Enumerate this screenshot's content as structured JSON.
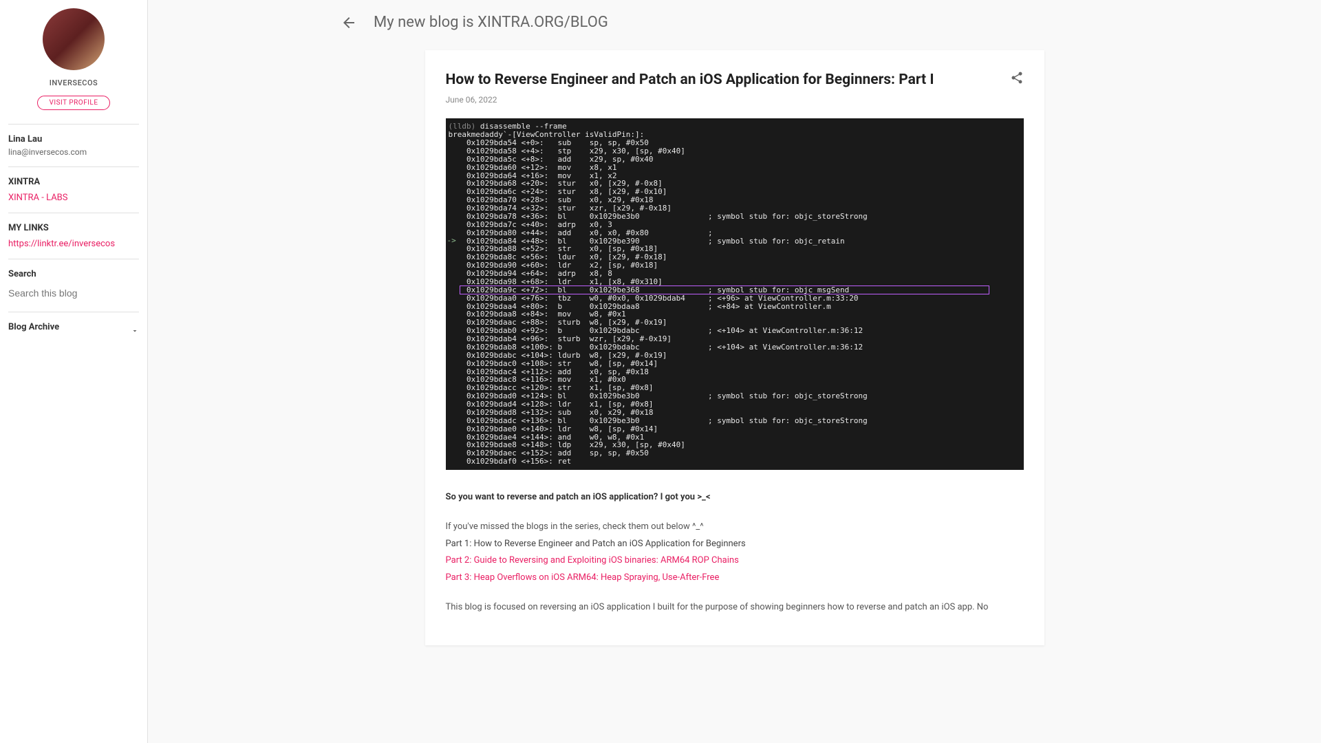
{
  "sidebar": {
    "author_name": "INVERSECOS",
    "visit_profile": "VISIT PROFILE",
    "contact": {
      "name": "Lina Lau",
      "email": "lina@inversecos.com"
    },
    "xintra": {
      "heading": "XINTRA",
      "link": "XINTRA - LABS"
    },
    "mylinks": {
      "heading": "MY LINKS",
      "link": "https://linktr.ee/inversecos"
    },
    "search": {
      "heading": "Search",
      "placeholder": "Search this blog"
    },
    "archive": {
      "heading": "Blog Archive"
    }
  },
  "header": {
    "blog_title": "My new blog is XINTRA.ORG/BLOG"
  },
  "post": {
    "title": "How to Reverse Engineer and Patch an iOS Application for Beginners: Part I",
    "date": "June 06, 2022",
    "body": {
      "p1": "So you want to reverse and patch an iOS application? I got you >_<",
      "p2": "If you've missed the blogs in the series, check them out below ^_^",
      "p3": "Part 1: How to Reverse Engineer and Patch an iOS Application for Beginners",
      "p4": "Part 2: Guide to Reversing and Exploiting iOS binaries: ARM64 ROP Chains",
      "p5": "Part 3: Heap Overflows on iOS ARM64: Heap Spraying, Use-After-Free",
      "p6": "This blog is focused on reversing an iOS application I built for the purpose of showing beginners how to reverse and patch an iOS app. No"
    },
    "disasm": {
      "prompt": "(lldb) ",
      "cmd": "disassemble --frame",
      "header": "breakmedaddy`-[ViewController isValidPin:]:",
      "lines": [
        "    0x1029bda54 <+0>:   sub    sp, sp, #0x50",
        "    0x1029bda58 <+4>:   stp    x29, x30, [sp, #0x40]",
        "    0x1029bda5c <+8>:   add    x29, sp, #0x40",
        "    0x1029bda60 <+12>:  mov    x8, x1",
        "    0x1029bda64 <+16>:  mov    x1, x2",
        "    0x1029bda68 <+20>:  stur   x0, [x29, #-0x8]",
        "    0x1029bda6c <+24>:  stur   x8, [x29, #-0x10]",
        "    0x1029bda70 <+28>:  sub    x0, x29, #0x18",
        "    0x1029bda74 <+32>:  stur   xzr, [x29, #-0x18]",
        "    0x1029bda78 <+36>:  bl     0x1029be3b0               ; symbol stub for: objc_storeStrong",
        "    0x1029bda7c <+40>:  adrp   x0, 3",
        "    0x1029bda80 <+44>:  add    x0, x0, #0x80             ;",
        "    0x1029bda84 <+48>:  bl     0x1029be390               ; symbol stub for: objc_retain",
        "    0x1029bda88 <+52>:  str    x0, [sp, #0x18]",
        "    0x1029bda8c <+56>:  ldur   x0, [x29, #-0x18]",
        "    0x1029bda90 <+60>:  ldr    x2, [sp, #0x18]",
        "    0x1029bda94 <+64>:  adrp   x8, 8",
        "    0x1029bda98 <+68>:  ldr    x1, [x8, #0x310]",
        "    0x1029bda9c <+72>:  bl     0x1029be368               ; symbol stub for: objc_msgSend",
        "    0x1029bdaa0 <+76>:  tbz    w0, #0x0, 0x1029bdab4     ; <+96> at ViewController.m:33:20",
        "    0x1029bdaa4 <+80>:  b      0x1029bdaa8               ; <+84> at ViewController.m",
        "    0x1029bdaa8 <+84>:  mov    w8, #0x1",
        "    0x1029bdaac <+88>:  sturb  w8, [x29, #-0x19]",
        "    0x1029bdab0 <+92>:  b      0x1029bdabc               ; <+104> at ViewController.m:36:12",
        "    0x1029bdab4 <+96>:  sturb  wzr, [x29, #-0x19]",
        "    0x1029bdab8 <+100>: b      0x1029bdabc               ; <+104> at ViewController.m:36:12",
        "    0x1029bdabc <+104>: ldurb  w8, [x29, #-0x19]",
        "    0x1029bdac0 <+108>: str    w8, [sp, #0x14]",
        "    0x1029bdac4 <+112>: add    x0, sp, #0x18",
        "    0x1029bdac8 <+116>: mov    x1, #0x0",
        "    0x1029bdacc <+120>: str    x1, [sp, #0x8]",
        "    0x1029bdad0 <+124>: bl     0x1029be3b0               ; symbol stub for: objc_storeStrong",
        "    0x1029bdad4 <+128>: ldr    x1, [sp, #0x8]",
        "    0x1029bdad8 <+132>: sub    x0, x29, #0x18",
        "    0x1029bdadc <+136>: bl     0x1029be3b0               ; symbol stub for: objc_storeStrong",
        "    0x1029bdae0 <+140>: ldr    w8, [sp, #0x14]",
        "    0x1029bdae4 <+144>: and    w0, w8, #0x1",
        "    0x1029bdae8 <+148>: ldp    x29, x30, [sp, #0x40]",
        "    0x1029bdaec <+152>: add    sp, sp, #0x50",
        "    0x1029bdaf0 <+156>: ret"
      ],
      "highlight_index": 18,
      "arrow_index": 12
    }
  }
}
